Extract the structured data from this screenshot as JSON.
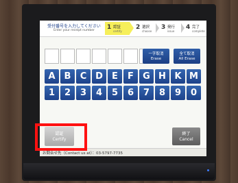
{
  "header": {
    "title_jp": "受付番号を入力してください",
    "title_en": "Enter your receipt number",
    "steps": [
      {
        "num": "1",
        "jp": "認証",
        "en": "certify"
      },
      {
        "num": "2",
        "jp": "選択",
        "en": "choose"
      },
      {
        "num": "3",
        "jp": "発行",
        "en": "issue"
      },
      {
        "num": "4",
        "jp": "完了",
        "en": "complete"
      }
    ]
  },
  "input": {
    "boxes": [
      "",
      "",
      "",
      "",
      "",
      "",
      ""
    ]
  },
  "actions": {
    "clear_one_jp": "一字取消",
    "clear_one_en": "Erase",
    "clear_all_jp": "全て取消",
    "clear_all_en": "All Erase"
  },
  "keypad": {
    "letters": [
      "A",
      "B",
      "C",
      "D",
      "E",
      "F",
      "G",
      "H",
      "K",
      "M"
    ],
    "digits": [
      "1",
      "2",
      "3",
      "4",
      "5",
      "6",
      "7",
      "8",
      "9",
      "0"
    ]
  },
  "buttons": {
    "certify_jp": "認証",
    "certify_en": "Certify",
    "cancel_jp": "終了",
    "cancel_en": "Cancel"
  },
  "footer": {
    "contact": "お問合せ先（Contact us at）：03-5797-7735"
  },
  "colors": {
    "key_blue": "#1d428a",
    "active_step": "#f6ef5a",
    "highlight": "#ff1111"
  }
}
